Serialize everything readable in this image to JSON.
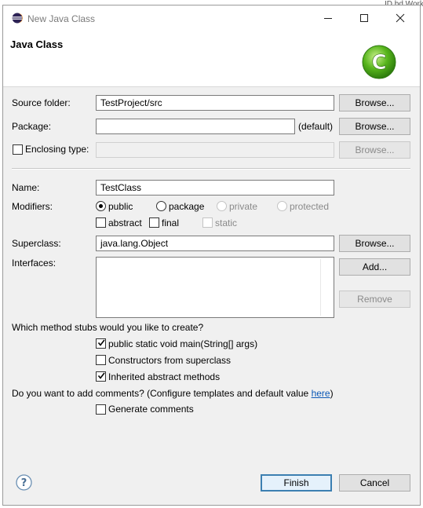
{
  "background": {
    "peek_text": "ID bd Workspace"
  },
  "window": {
    "title": "New Java Class",
    "app_icon": "eclipse-icon",
    "controls": {
      "minimize": "minimize-icon",
      "maximize": "maximize-icon",
      "close": "close-icon"
    }
  },
  "banner": {
    "title": "Java Class",
    "icon": "java-class-wizard-icon"
  },
  "form": {
    "source_folder": {
      "label": "Source folder:",
      "value": "TestProject/src",
      "browse": "Browse..."
    },
    "package": {
      "label": "Package:",
      "value": "",
      "suffix": "(default)",
      "browse": "Browse..."
    },
    "enclosing_type": {
      "label": "Enclosing type:",
      "checked": false,
      "value": "",
      "browse": "Browse..."
    },
    "name": {
      "label": "Name:",
      "value": "TestClass"
    },
    "modifiers": {
      "label": "Modifiers:",
      "access": [
        {
          "label": "public",
          "selected": true,
          "enabled": true
        },
        {
          "label": "package",
          "selected": false,
          "enabled": true
        },
        {
          "label": "private",
          "selected": false,
          "enabled": false
        },
        {
          "label": "protected",
          "selected": false,
          "enabled": false
        }
      ],
      "flags": [
        {
          "label": "abstract",
          "checked": false,
          "enabled": true
        },
        {
          "label": "final",
          "checked": false,
          "enabled": true
        },
        {
          "label": "static",
          "checked": false,
          "enabled": false
        }
      ]
    },
    "superclass": {
      "label": "Superclass:",
      "value": "java.lang.Object",
      "browse": "Browse..."
    },
    "interfaces": {
      "label": "Interfaces:",
      "items": [],
      "add": "Add...",
      "remove": "Remove"
    },
    "stubs": {
      "question": "Which method stubs would you like to create?",
      "options": [
        {
          "label": "public static void main(String[] args)",
          "checked": true
        },
        {
          "label": "Constructors from superclass",
          "checked": false
        },
        {
          "label": "Inherited abstract methods",
          "checked": true
        }
      ]
    },
    "comments": {
      "question": "Do you want to add comments? (Configure templates and default value ",
      "link": "here",
      "question_end": ")",
      "option": {
        "label": "Generate comments",
        "checked": false
      }
    }
  },
  "footer": {
    "help_icon": "help-icon",
    "finish": "Finish",
    "cancel": "Cancel"
  }
}
